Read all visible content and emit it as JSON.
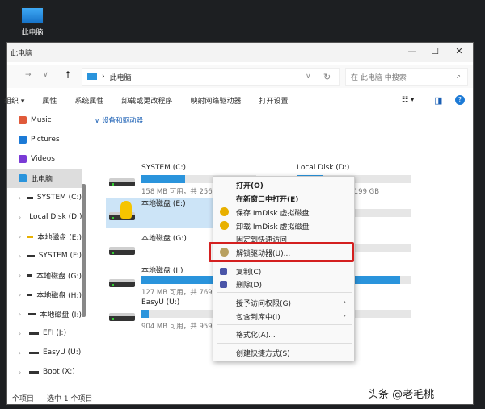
{
  "desktop": {
    "icon_label": "此电脑"
  },
  "window": {
    "title": "此电脑",
    "min": "—",
    "max": "☐",
    "close": "✕"
  },
  "nav": {
    "forward": "→",
    "recent": "∨",
    "up": "↑",
    "path": "此电脑",
    "sep": "›",
    "dropdown": "∨",
    "refresh": "↻",
    "search_placeholder": "在 此电脑 中搜索",
    "search_icon": "⌕"
  },
  "toolbar": {
    "items": [
      "组织 ▾",
      "属性",
      "系统属性",
      "卸载或更改程序",
      "映射网络驱动器",
      "打开设置"
    ],
    "view": "☷ ▾",
    "pane": "◨",
    "help": "?"
  },
  "sidebar": {
    "items": [
      {
        "label": "Music",
        "icon": "music-icon",
        "color": "#e05a3a"
      },
      {
        "label": "Pictures",
        "icon": "pictures-icon",
        "color": "#1c7ad6"
      },
      {
        "label": "Videos",
        "icon": "videos-icon",
        "color": "#7a3ad6"
      },
      {
        "label": "此电脑",
        "icon": "computer-icon",
        "color": "#2a94dc"
      },
      {
        "label": "SYSTEM (C:)"
      },
      {
        "label": "Local Disk (D:)"
      },
      {
        "label": "本地磁盘 (E:)"
      },
      {
        "label": "SYSTEM (F:)"
      },
      {
        "label": "本地磁盘 (G:)"
      },
      {
        "label": "本地磁盘 (H:)"
      },
      {
        "label": "本地磁盘 (I:)"
      },
      {
        "label": "EFI (J:)"
      },
      {
        "label": "EasyU (U:)"
      },
      {
        "label": "Boot (X:)"
      }
    ]
  },
  "content": {
    "group": "设备和驱动器",
    "drives": [
      {
        "name": "SYSTEM (C:)",
        "size": "158 MB 可用，共 256 MB",
        "used": 0.38
      },
      {
        "name": "Local Disk (D:)",
        "size": "153 GB 可用，共 199 GB",
        "used": 0.23
      },
      {
        "name": "本地磁盘 (E:)",
        "size": "",
        "locked": true
      },
      {
        "name": "SYSTEM (F:)",
        "size": "… 256 MB",
        "used": 0.4
      },
      {
        "name": "本地磁盘 (G:)",
        "size": ""
      },
      {
        "name": "",
        "size": "… 755 MB",
        "used": 0.5
      },
      {
        "name": "本地磁盘 (I:)",
        "size": "127 MB 可用，共 769 …",
        "used": 0.83
      },
      {
        "name": "",
        "size": "… 41 GB",
        "used": 0.9
      },
      {
        "name": "EasyU (U:)",
        "size": "904 MB 可用，共 959 …",
        "used": 0.06
      },
      {
        "name": "",
        "size": "… 2.0 GB",
        "used": 0.5
      }
    ]
  },
  "status": {
    "count": "个项目",
    "selected": "选中 1 个项目"
  },
  "menu": {
    "items": [
      "打开(O)",
      "在新窗口中打开(E)",
      "保存 ImDisk 虚拟磁盘",
      "卸载 ImDisk 虚拟磁盘",
      "固定到快速访问",
      "解锁驱动器(U)...",
      "复制(C)",
      "删除(D)",
      "授予访问权限(G)",
      "包含到库中(I)",
      "格式化(A)...",
      "创建快捷方式(S)"
    ],
    "arrow": "›"
  },
  "highlight_color": "#d42020",
  "watermark": "头条 @老毛桃"
}
